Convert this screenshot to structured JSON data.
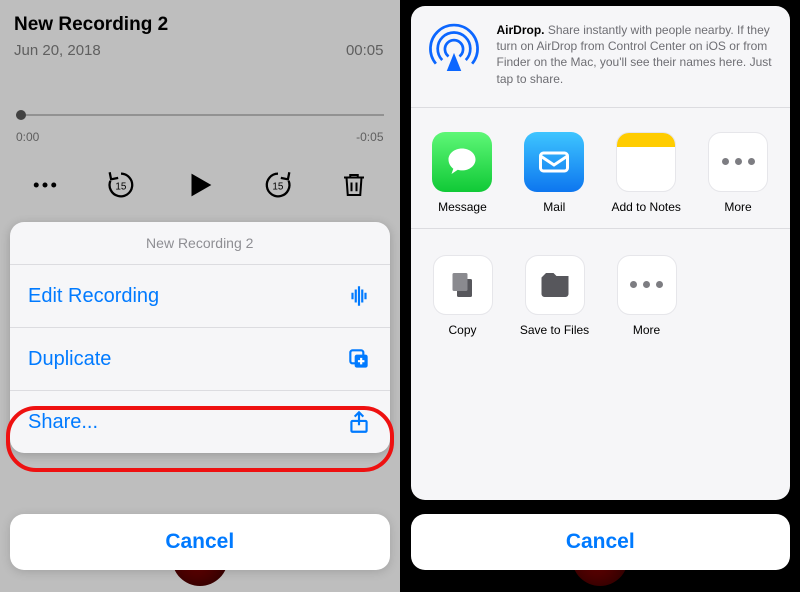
{
  "left": {
    "title": "New Recording 2",
    "date": "Jun 20, 2018",
    "duration": "00:05",
    "elapsed": "0:00",
    "remaining": "-0:05",
    "sheet_title": "New Recording 2",
    "actions": {
      "edit": "Edit Recording",
      "duplicate": "Duplicate",
      "share": "Share..."
    },
    "cancel": "Cancel"
  },
  "right": {
    "airdrop_bold": "AirDrop.",
    "airdrop_text": " Share instantly with people nearby. If they turn on AirDrop from Control Center on iOS or from Finder on the Mac, you'll see their names here. Just tap to share.",
    "apps": {
      "message": "Message",
      "mail": "Mail",
      "notes": "Add to Notes",
      "more": "More"
    },
    "acts": {
      "copy": "Copy",
      "save": "Save to Files",
      "more": "More"
    },
    "cancel": "Cancel"
  }
}
